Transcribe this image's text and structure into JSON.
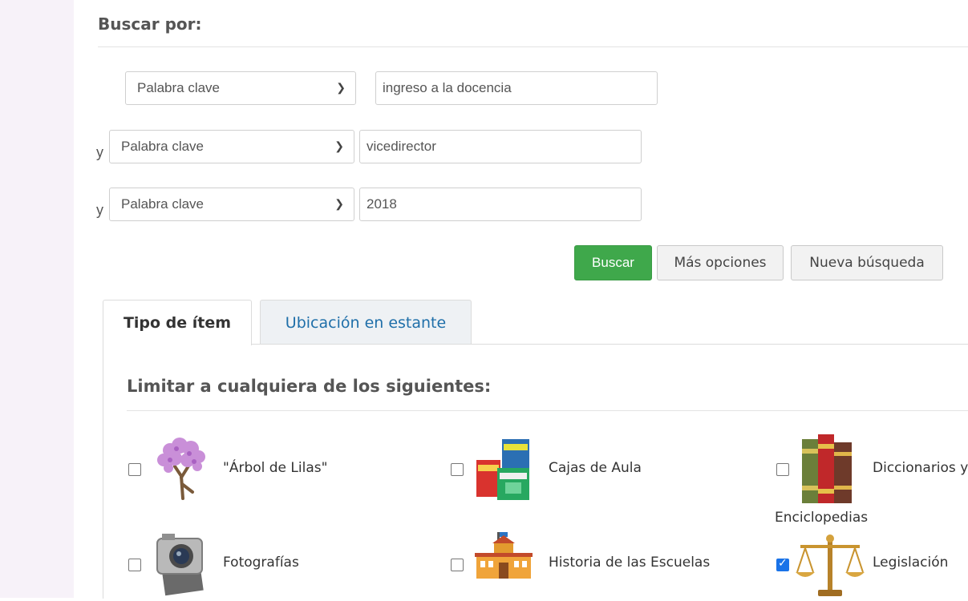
{
  "search": {
    "heading": "Buscar por:",
    "rows": [
      {
        "operator": "",
        "field": "Palabra clave",
        "value": "ingreso a la docencia"
      },
      {
        "operator": "y",
        "field": "Palabra clave",
        "value": "vicedirector"
      },
      {
        "operator": "y",
        "field": "Palabra clave",
        "value": "2018"
      }
    ],
    "buttons": {
      "search": "Buscar",
      "more": "Más opciones",
      "new": "Nueva búsqueda"
    }
  },
  "tabs": [
    {
      "label": "Tipo de ítem",
      "active": true
    },
    {
      "label": "Ubicación en estante",
      "active": false
    }
  ],
  "limits": {
    "title": "Limitar a cualquiera de los siguientes:",
    "items": [
      {
        "label": "\"Árbol de Lilas\"",
        "checked": false,
        "icon": "lilac-tree-icon"
      },
      {
        "label": "Cajas de Aula",
        "checked": false,
        "icon": "classroom-boxes-icon"
      },
      {
        "label": "Diccionarios y",
        "label2": "Enciclopedias",
        "checked": false,
        "icon": "books-icon"
      },
      {
        "label": "Fotografías",
        "checked": false,
        "icon": "camera-icon"
      },
      {
        "label": "Historia de las Escuelas",
        "checked": false,
        "icon": "school-building-icon"
      },
      {
        "label": "Legislación",
        "checked": true,
        "icon": "scales-icon"
      }
    ]
  },
  "colors": {
    "accent": "#3fa84b",
    "link": "#1f6fa9",
    "checkbox": "#1a73e8"
  }
}
